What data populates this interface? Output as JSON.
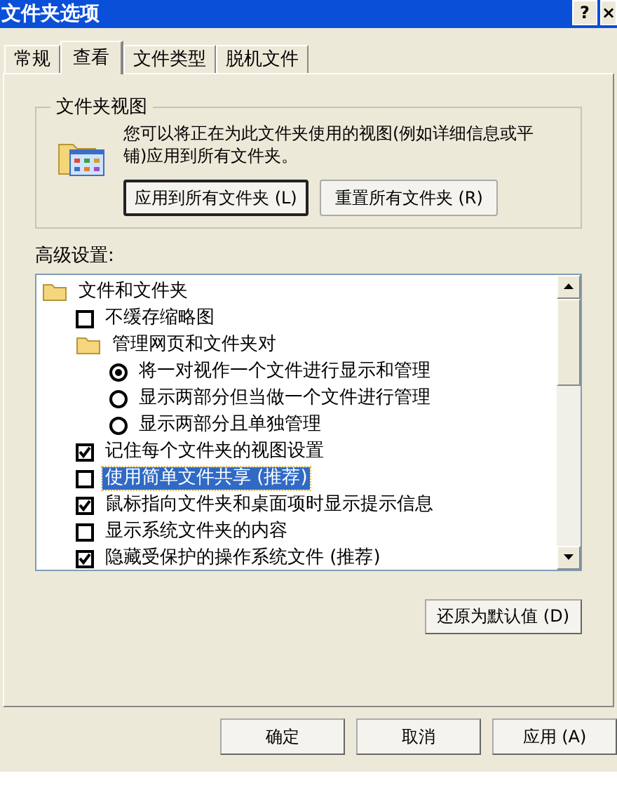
{
  "window": {
    "title": "文件夹选项",
    "buttons": [
      "?",
      "×"
    ]
  },
  "tabs": [
    {
      "label": "常规",
      "selected": false
    },
    {
      "label": "查看",
      "selected": true
    },
    {
      "label": "文件类型",
      "selected": false
    },
    {
      "label": "脱机文件",
      "selected": false
    }
  ],
  "folder_views": {
    "title": "文件夹视图",
    "description": "您可以将正在为此文件夹使用的视图(例如详细信息或平铺)应用到所有文件夹。",
    "buttons": [
      {
        "label": "应用到所有文件夹 (L)",
        "default": true
      },
      {
        "label": "重置所有文件夹 (R)",
        "default": false
      }
    ]
  },
  "advanced": {
    "title": "高级设置:",
    "items": [
      {
        "kind": "folder",
        "label": "文件和文件夹",
        "selected": false,
        "children": [
          {
            "kind": "checkbox",
            "label": "不缓存缩略图",
            "checked": false,
            "selected": false
          },
          {
            "kind": "folder",
            "label": "管理网页和文件夹对",
            "selected": false,
            "children": [
              {
                "kind": "radio",
                "label": "将一对视作一个文件进行显示和管理",
                "checked": true,
                "selected": false
              },
              {
                "kind": "radio",
                "label": "显示两部分但当做一个文件进行管理",
                "checked": false,
                "selected": false
              },
              {
                "kind": "radio",
                "label": "显示两部分且单独管理",
                "checked": false,
                "selected": false
              }
            ]
          },
          {
            "kind": "checkbox",
            "label": "记住每个文件夹的视图设置",
            "checked": true,
            "selected": false
          },
          {
            "kind": "checkbox",
            "label": "使用简单文件共享 (推荐)",
            "checked": false,
            "selected": true
          },
          {
            "kind": "checkbox",
            "label": "鼠标指向文件夹和桌面项时显示提示信息",
            "checked": true,
            "selected": false
          },
          {
            "kind": "checkbox",
            "label": "显示系统文件夹的内容",
            "checked": false,
            "selected": false
          },
          {
            "kind": "checkbox",
            "label": "隐藏受保护的操作系统文件 (推荐)",
            "checked": true,
            "selected": false
          }
        ]
      }
    ],
    "restore_button": "还原为默认值 (D)"
  },
  "footer_buttons": [
    "确定",
    "取消",
    "应用 (A)"
  ]
}
